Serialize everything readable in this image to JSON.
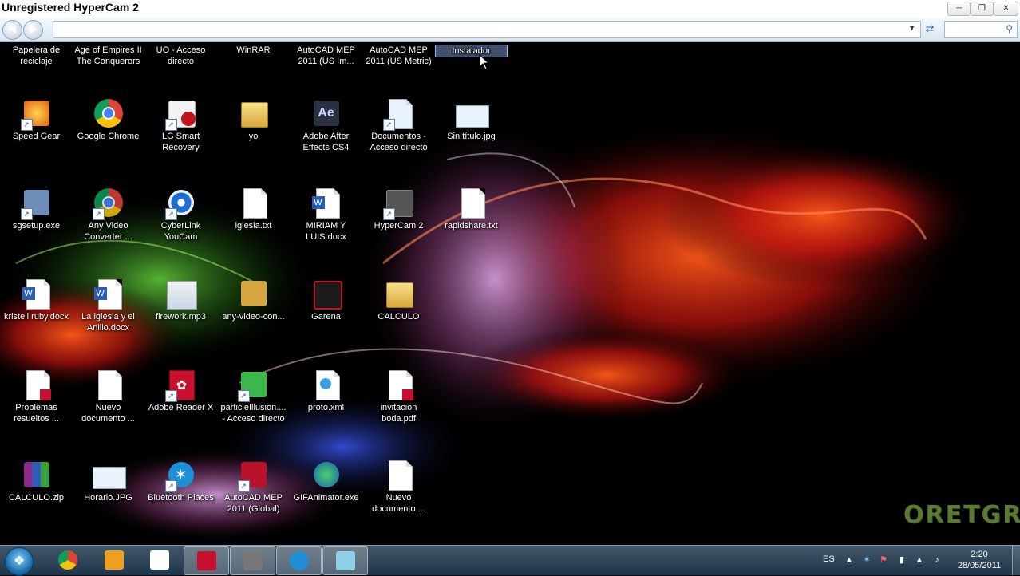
{
  "window": {
    "title": "Unregistered HyperCam 2",
    "controls": [
      "minimize-icon",
      "maximize-icon",
      "close-icon"
    ]
  },
  "explorer": {
    "address_value": "",
    "search_placeholder": ""
  },
  "desktop_icons": [
    {
      "label": "Papelera de reciclaje",
      "icon": "recycle-bin-icon",
      "shortcut": false,
      "kind": "bin"
    },
    {
      "label": "Age of Empires II The Conquerors",
      "icon": "age-of-empires-icon",
      "shortcut": true,
      "kind": "game"
    },
    {
      "label": "UO - Acceso directo",
      "icon": "shortcut-icon",
      "shortcut": true,
      "kind": "game"
    },
    {
      "label": "WinRAR",
      "icon": "winrar-icon",
      "shortcut": true,
      "kind": "rar"
    },
    {
      "label": "AutoCAD MEP 2011 (US Im...",
      "icon": "autocad-icon",
      "shortcut": true,
      "kind": "autocad"
    },
    {
      "label": "AutoCAD MEP 2011 (US Metric)",
      "icon": "autocad-icon",
      "shortcut": true,
      "kind": "autocad"
    },
    {
      "label": "Instalador",
      "icon": "installer-icon",
      "shortcut": false,
      "kind": "installer",
      "selected": true
    },
    {
      "label": "Speed Gear",
      "icon": "speed-gear-icon",
      "shortcut": true,
      "kind": "speedgear"
    },
    {
      "label": "Google Chrome",
      "icon": "chrome-icon",
      "shortcut": false,
      "kind": "chrome"
    },
    {
      "label": "LG Smart Recovery",
      "icon": "lg-recovery-icon",
      "shortcut": true,
      "kind": "lg"
    },
    {
      "label": "yo",
      "icon": "folder-icon",
      "shortcut": false,
      "kind": "folder"
    },
    {
      "label": "Adobe After Effects CS4",
      "icon": "after-effects-icon",
      "shortcut": false,
      "kind": "ae"
    },
    {
      "label": "Documentos - Acceso directo",
      "icon": "documents-icon",
      "shortcut": true,
      "kind": "docs"
    },
    {
      "label": "Sin título.jpg",
      "icon": "image-file-icon",
      "shortcut": false,
      "kind": "jpg"
    },
    {
      "label": "sgsetup.exe",
      "icon": "setup-exe-icon",
      "shortcut": true,
      "kind": "setup"
    },
    {
      "label": "Any Video Converter ...",
      "icon": "video-converter-icon",
      "shortcut": true,
      "kind": "avc"
    },
    {
      "label": "CyberLink YouCam",
      "icon": "youcam-icon",
      "shortcut": true,
      "kind": "youcam"
    },
    {
      "label": "iglesia.txt",
      "icon": "text-file-icon",
      "shortcut": false,
      "kind": "txt"
    },
    {
      "label": "MIRIAM Y LUIS.docx",
      "icon": "word-doc-icon",
      "shortcut": false,
      "kind": "docx"
    },
    {
      "label": "HyperCam 2",
      "icon": "hypercam-icon",
      "shortcut": true,
      "kind": "hypercam"
    },
    {
      "label": "rapidshare.txt",
      "icon": "text-file-icon",
      "shortcut": false,
      "kind": "txt"
    },
    {
      "label": "kristell ruby.docx",
      "icon": "word-doc-icon",
      "shortcut": false,
      "kind": "docx"
    },
    {
      "label": "La iglesia y el Anillo.docx",
      "icon": "word-doc-icon",
      "shortcut": false,
      "kind": "docx"
    },
    {
      "label": "firework.mp3",
      "icon": "audio-file-icon",
      "shortcut": false,
      "kind": "mp3"
    },
    {
      "label": "any-video-con...",
      "icon": "installer-package-icon",
      "shortcut": false,
      "kind": "pkg"
    },
    {
      "label": "Garena",
      "icon": "garena-icon",
      "shortcut": false,
      "kind": "garena"
    },
    {
      "label": "CALCULO",
      "icon": "folder-icon",
      "shortcut": false,
      "kind": "folder"
    },
    {
      "label": "Problemas resueltos ...",
      "icon": "pdf-file-icon",
      "shortcut": false,
      "kind": "pdfdoc"
    },
    {
      "label": "Nuevo documento ...",
      "icon": "text-file-icon",
      "shortcut": false,
      "kind": "txt"
    },
    {
      "label": "Adobe Reader X",
      "icon": "adobe-reader-icon",
      "shortcut": true,
      "kind": "pdf"
    },
    {
      "label": "particleIllusion.... - Acceso directo",
      "icon": "particle-illusion-icon",
      "shortcut": true,
      "kind": "particle"
    },
    {
      "label": "proto.xml",
      "icon": "xml-file-icon",
      "shortcut": false,
      "kind": "xml"
    },
    {
      "label": "invitacion boda.pdf",
      "icon": "pdf-file-icon",
      "shortcut": false,
      "kind": "pdfdoc"
    },
    {
      "label": "CALCULO.zip",
      "icon": "zip-archive-icon",
      "shortcut": false,
      "kind": "rar"
    },
    {
      "label": "Horario.JPG",
      "icon": "image-file-icon",
      "shortcut": false,
      "kind": "jpg"
    },
    {
      "label": "Bluetooth Places",
      "icon": "bluetooth-icon",
      "shortcut": true,
      "kind": "bt"
    },
    {
      "label": "AutoCAD MEP 2011 (Global)",
      "icon": "autocad-icon",
      "shortcut": true,
      "kind": "autocad"
    },
    {
      "label": "GIFAnimator.exe",
      "icon": "gif-animator-icon",
      "shortcut": false,
      "kind": "gif"
    },
    {
      "label": "Nuevo documento ...",
      "icon": "text-file-icon",
      "shortcut": false,
      "kind": "txt"
    }
  ],
  "taskbar": {
    "start": "windows-start-icon",
    "pinned": [
      {
        "name": "chrome-icon",
        "color": "#db4437",
        "active": false
      },
      {
        "name": "media-player-icon",
        "color": "#f0a020",
        "active": false
      },
      {
        "name": "blank-document-icon",
        "color": "#ffffff",
        "active": false
      },
      {
        "name": "adobe-reader-icon",
        "color": "#c8102e",
        "active": true
      },
      {
        "name": "hypercam-icon",
        "color": "#777777",
        "active": true
      },
      {
        "name": "bluetooth-icon",
        "color": "#1d8fd6",
        "active": true
      },
      {
        "name": "window-icon",
        "color": "#8ed0e8",
        "active": true
      }
    ],
    "language": "ES",
    "time": "2:20",
    "date": "28/05/2011"
  },
  "watermark": "ORETGR"
}
